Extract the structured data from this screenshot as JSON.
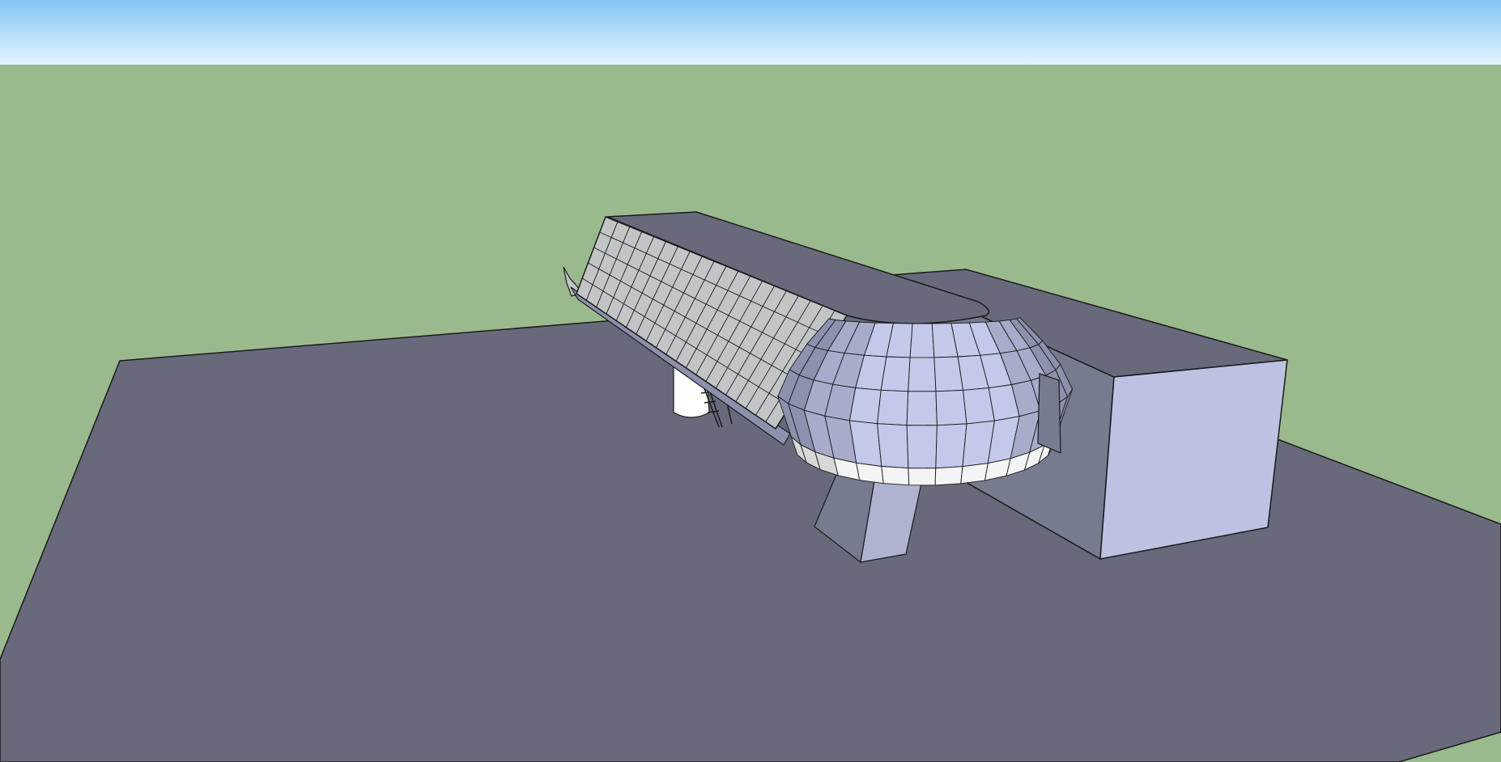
{
  "viewport": {
    "colors": {
      "sky_top": "#84c6f5",
      "sky_bottom": "#e3f3fd",
      "ground": "#9aba8e",
      "edge": "#1a1a1a",
      "platform": "#686a7c",
      "roof": "#686a7c",
      "block_front": "#bdc2e3",
      "block_side": "#777b90",
      "awning_tiles": "#c3c4c6",
      "glass_light": "#c3c9ea",
      "glass_mid": "#a7acca",
      "glass_dark": "#8c91ad",
      "fascia": "#f4f4f4",
      "column_front": "#b0b3d0",
      "column_side": "#777b90",
      "pillar": "#ffffff"
    }
  }
}
